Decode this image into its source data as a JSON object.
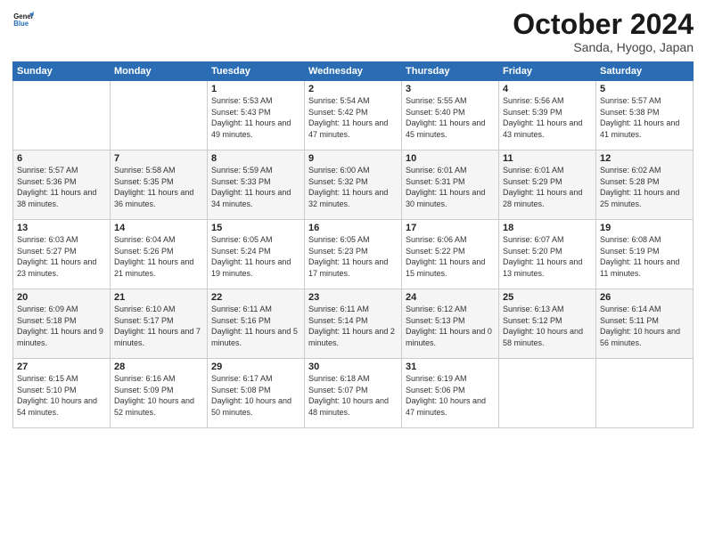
{
  "header": {
    "logo_general": "General",
    "logo_blue": "Blue",
    "month_title": "October 2024",
    "location": "Sanda, Hyogo, Japan"
  },
  "weekdays": [
    "Sunday",
    "Monday",
    "Tuesday",
    "Wednesday",
    "Thursday",
    "Friday",
    "Saturday"
  ],
  "weeks": [
    [
      {
        "day": "",
        "info": ""
      },
      {
        "day": "",
        "info": ""
      },
      {
        "day": "1",
        "info": "Sunrise: 5:53 AM\nSunset: 5:43 PM\nDaylight: 11 hours and 49 minutes."
      },
      {
        "day": "2",
        "info": "Sunrise: 5:54 AM\nSunset: 5:42 PM\nDaylight: 11 hours and 47 minutes."
      },
      {
        "day": "3",
        "info": "Sunrise: 5:55 AM\nSunset: 5:40 PM\nDaylight: 11 hours and 45 minutes."
      },
      {
        "day": "4",
        "info": "Sunrise: 5:56 AM\nSunset: 5:39 PM\nDaylight: 11 hours and 43 minutes."
      },
      {
        "day": "5",
        "info": "Sunrise: 5:57 AM\nSunset: 5:38 PM\nDaylight: 11 hours and 41 minutes."
      }
    ],
    [
      {
        "day": "6",
        "info": "Sunrise: 5:57 AM\nSunset: 5:36 PM\nDaylight: 11 hours and 38 minutes."
      },
      {
        "day": "7",
        "info": "Sunrise: 5:58 AM\nSunset: 5:35 PM\nDaylight: 11 hours and 36 minutes."
      },
      {
        "day": "8",
        "info": "Sunrise: 5:59 AM\nSunset: 5:33 PM\nDaylight: 11 hours and 34 minutes."
      },
      {
        "day": "9",
        "info": "Sunrise: 6:00 AM\nSunset: 5:32 PM\nDaylight: 11 hours and 32 minutes."
      },
      {
        "day": "10",
        "info": "Sunrise: 6:01 AM\nSunset: 5:31 PM\nDaylight: 11 hours and 30 minutes."
      },
      {
        "day": "11",
        "info": "Sunrise: 6:01 AM\nSunset: 5:29 PM\nDaylight: 11 hours and 28 minutes."
      },
      {
        "day": "12",
        "info": "Sunrise: 6:02 AM\nSunset: 5:28 PM\nDaylight: 11 hours and 25 minutes."
      }
    ],
    [
      {
        "day": "13",
        "info": "Sunrise: 6:03 AM\nSunset: 5:27 PM\nDaylight: 11 hours and 23 minutes."
      },
      {
        "day": "14",
        "info": "Sunrise: 6:04 AM\nSunset: 5:26 PM\nDaylight: 11 hours and 21 minutes."
      },
      {
        "day": "15",
        "info": "Sunrise: 6:05 AM\nSunset: 5:24 PM\nDaylight: 11 hours and 19 minutes."
      },
      {
        "day": "16",
        "info": "Sunrise: 6:05 AM\nSunset: 5:23 PM\nDaylight: 11 hours and 17 minutes."
      },
      {
        "day": "17",
        "info": "Sunrise: 6:06 AM\nSunset: 5:22 PM\nDaylight: 11 hours and 15 minutes."
      },
      {
        "day": "18",
        "info": "Sunrise: 6:07 AM\nSunset: 5:20 PM\nDaylight: 11 hours and 13 minutes."
      },
      {
        "day": "19",
        "info": "Sunrise: 6:08 AM\nSunset: 5:19 PM\nDaylight: 11 hours and 11 minutes."
      }
    ],
    [
      {
        "day": "20",
        "info": "Sunrise: 6:09 AM\nSunset: 5:18 PM\nDaylight: 11 hours and 9 minutes."
      },
      {
        "day": "21",
        "info": "Sunrise: 6:10 AM\nSunset: 5:17 PM\nDaylight: 11 hours and 7 minutes."
      },
      {
        "day": "22",
        "info": "Sunrise: 6:11 AM\nSunset: 5:16 PM\nDaylight: 11 hours and 5 minutes."
      },
      {
        "day": "23",
        "info": "Sunrise: 6:11 AM\nSunset: 5:14 PM\nDaylight: 11 hours and 2 minutes."
      },
      {
        "day": "24",
        "info": "Sunrise: 6:12 AM\nSunset: 5:13 PM\nDaylight: 11 hours and 0 minutes."
      },
      {
        "day": "25",
        "info": "Sunrise: 6:13 AM\nSunset: 5:12 PM\nDaylight: 10 hours and 58 minutes."
      },
      {
        "day": "26",
        "info": "Sunrise: 6:14 AM\nSunset: 5:11 PM\nDaylight: 10 hours and 56 minutes."
      }
    ],
    [
      {
        "day": "27",
        "info": "Sunrise: 6:15 AM\nSunset: 5:10 PM\nDaylight: 10 hours and 54 minutes."
      },
      {
        "day": "28",
        "info": "Sunrise: 6:16 AM\nSunset: 5:09 PM\nDaylight: 10 hours and 52 minutes."
      },
      {
        "day": "29",
        "info": "Sunrise: 6:17 AM\nSunset: 5:08 PM\nDaylight: 10 hours and 50 minutes."
      },
      {
        "day": "30",
        "info": "Sunrise: 6:18 AM\nSunset: 5:07 PM\nDaylight: 10 hours and 48 minutes."
      },
      {
        "day": "31",
        "info": "Sunrise: 6:19 AM\nSunset: 5:06 PM\nDaylight: 10 hours and 47 minutes."
      },
      {
        "day": "",
        "info": ""
      },
      {
        "day": "",
        "info": ""
      }
    ]
  ]
}
